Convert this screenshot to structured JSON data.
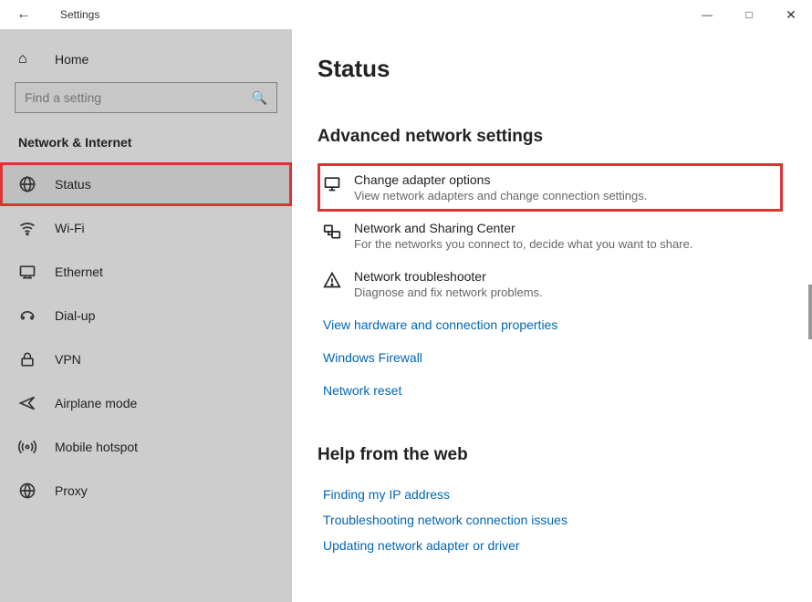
{
  "window": {
    "title": "Settings"
  },
  "sidebar": {
    "home": "Home",
    "search_placeholder": "Find a setting",
    "category": "Network & Internet",
    "items": [
      {
        "label": "Status",
        "icon": "status"
      },
      {
        "label": "Wi-Fi",
        "icon": "wifi"
      },
      {
        "label": "Ethernet",
        "icon": "ethernet"
      },
      {
        "label": "Dial-up",
        "icon": "dialup"
      },
      {
        "label": "VPN",
        "icon": "vpn"
      },
      {
        "label": "Airplane mode",
        "icon": "airplane"
      },
      {
        "label": "Mobile hotspot",
        "icon": "hotspot"
      },
      {
        "label": "Proxy",
        "icon": "proxy"
      }
    ]
  },
  "main": {
    "page_title": "Status",
    "adv_heading": "Advanced network settings",
    "options": [
      {
        "title": "Change adapter options",
        "desc": "View network adapters and change connection settings."
      },
      {
        "title": "Network and Sharing Center",
        "desc": "For the networks you connect to, decide what you want to share."
      },
      {
        "title": "Network troubleshooter",
        "desc": "Diagnose and fix network problems."
      }
    ],
    "links": [
      "View hardware and connection properties",
      "Windows Firewall",
      "Network reset"
    ],
    "help_heading": "Help from the web",
    "help_links": [
      "Finding my IP address",
      "Troubleshooting network connection issues",
      "Updating network adapter or driver"
    ]
  }
}
